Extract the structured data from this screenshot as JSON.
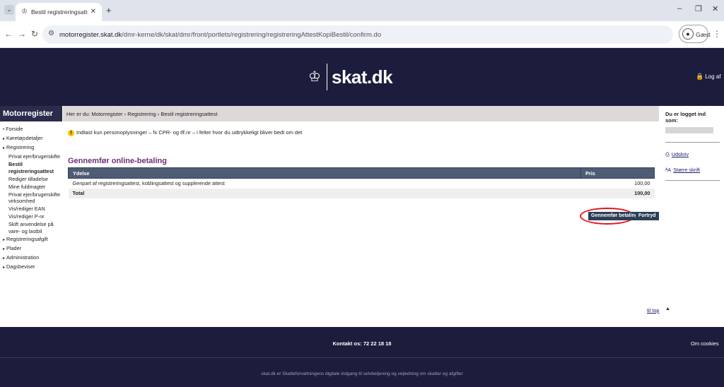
{
  "browser": {
    "tab_title": "Bestil registreringsattest - DMR",
    "url_host": "motorregister.skat.dk",
    "url_path": "/dmr-kerne/dk/skat/dmr/front/portlets/registrering/registreringAttestKopiBestil/confirm.do",
    "profile_label": "Gæst"
  },
  "header": {
    "logo_text": "skat.dk",
    "logout_label": "Log af"
  },
  "leftnav": {
    "title": "Motorregister",
    "items": [
      {
        "label": "Forside",
        "level": 0,
        "arrow": false
      },
      {
        "label": "Køretøjsdetaljer",
        "level": 0,
        "arrow": true
      },
      {
        "label": "Registrering",
        "level": 0,
        "arrow": true
      },
      {
        "label": "Privat ejer/brugerskifte",
        "level": 1
      },
      {
        "label": "Bestil registreringsattest",
        "level": 1,
        "active": true
      },
      {
        "label": "Rediger tilladelse",
        "level": 1
      },
      {
        "label": "Mine fuldmagter",
        "level": 1
      },
      {
        "label": "Privat ejer/brugerskifte virksomhed",
        "level": 1
      },
      {
        "label": "Vis/rediger EAN",
        "level": 1
      },
      {
        "label": "Vis/rediger P-nr",
        "level": 1
      },
      {
        "label": "Skift anvendelse på vare- og lastbil",
        "level": 1
      },
      {
        "label": "Registreringsafgift",
        "level": 0,
        "arrow": true
      },
      {
        "label": "Plader",
        "level": 0,
        "arrow": true
      },
      {
        "label": "Administration",
        "level": 0,
        "arrow": true
      },
      {
        "label": "Dagsbeviser",
        "level": 0,
        "arrow": true
      }
    ]
  },
  "breadcrumb": "Her er du: Motorregister › Registrering › Bestil registreringsattest",
  "right": {
    "logged_in_label": "Du er logget ind som:",
    "print_label": "Udskriv",
    "font_label": "Større skrift"
  },
  "main": {
    "notice": "Indtast kun personoplysninger – fx CPR- og tlf.nr – i felter hvor du udtrykkeligt bliver bedt om det",
    "section_title": "Gennemfør online-betaling",
    "table": {
      "col_item": "Ydelse",
      "col_price": "Pris",
      "rows": [
        {
          "item": "Genpart af registreringsattest, koblingsattest og supplerende attest",
          "price": "100,00"
        }
      ],
      "total_label": "Total",
      "total_value": "100,00"
    },
    "pay_button": "Gennemfør betaling",
    "cancel_button": "Fortryd",
    "to_top": "til top"
  },
  "footer": {
    "contact": "Kontakt os: 72 22 18 18",
    "cookies": "Om cookies",
    "note": "skat.dk er Skatteforvaltningens digitale indgang til selvbetjening og vejledning om skatter og afgifter"
  },
  "colors": {
    "header_bg": "#1c1c3c",
    "table_header": "#4e5d73",
    "section_title": "#6e2e75",
    "highlight": "#e3141b"
  }
}
